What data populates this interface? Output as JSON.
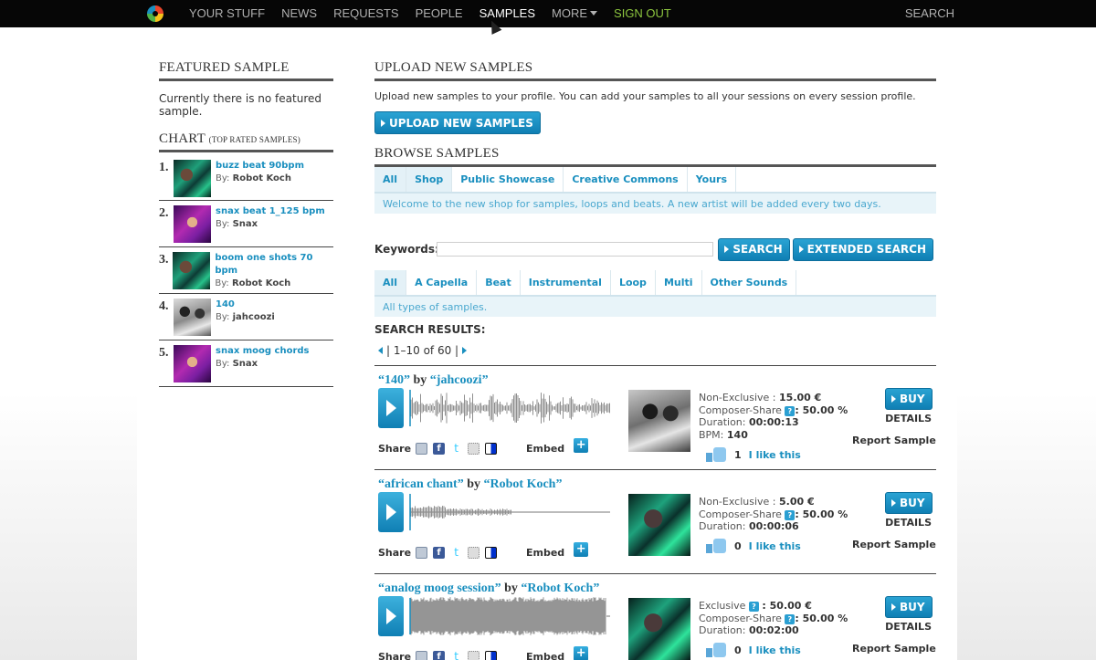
{
  "nav": {
    "items": [
      {
        "label": "YOUR STUFF",
        "active": false
      },
      {
        "label": "NEWS",
        "active": false
      },
      {
        "label": "REQUESTS",
        "active": false
      },
      {
        "label": "PEOPLE",
        "active": false
      },
      {
        "label": "SAMPLES",
        "active": true
      },
      {
        "label": "MORE",
        "active": false
      },
      {
        "label": "SIGN OUT",
        "active": false
      }
    ],
    "search": "SEARCH"
  },
  "left": {
    "featured_title": "FEATURED SAMPLE",
    "featured_text": "Currently there is no featured sample.",
    "chart_title": "CHART",
    "chart_subtitle": "(TOP RATED SAMPLES)",
    "chart": [
      {
        "num": "1.",
        "title": "buzz beat 90bpm",
        "by_label": "By:",
        "by": "Robot Koch"
      },
      {
        "num": "2.",
        "title": "snax beat 1_125 bpm",
        "by_label": "By:",
        "by": "Snax"
      },
      {
        "num": "3.",
        "title": "boom one shots 70 bpm",
        "by_label": "By:",
        "by": "Robot Koch"
      },
      {
        "num": "4.",
        "title": "140",
        "by_label": "By:",
        "by": "jahcoozi"
      },
      {
        "num": "5.",
        "title": "snax moog chords",
        "by_label": "By:",
        "by": "Snax"
      }
    ]
  },
  "upload": {
    "title": "UPLOAD NEW SAMPLES",
    "text": "Upload new samples to your profile. You can add your samples to all your sessions on every session profile.",
    "button": "UPLOAD NEW SAMPLES"
  },
  "browse": {
    "title": "BROWSE SAMPLES",
    "tabs": [
      "All",
      "Shop",
      "Public Showcase",
      "Creative Commons",
      "Yours"
    ],
    "note": "Welcome to the new shop for samples, loops and beats. A new artist will be added every two days.",
    "keywords_label": "Keywords:",
    "search_button": "SEARCH",
    "extended_button": "EXTENDED SEARCH",
    "categories": [
      "All",
      "A Capella",
      "Beat",
      "Instrumental",
      "Loop",
      "Multi",
      "Other Sounds"
    ],
    "category_note": "All types of samples.",
    "results_label": "SEARCH RESULTS:",
    "pager": "| 1–10 of 60 |"
  },
  "samples": [
    {
      "title": "“140”",
      "by_word": "by",
      "artist": "“jahcoozi”",
      "share": "Share",
      "embed": "Embed",
      "line1_label": "Non-Exclusive :",
      "line1_value": "15.00 €",
      "line2_label": "Composer-Share",
      "line2_value": ": 50.00 %",
      "line3_label": "Duration:",
      "line3_value": "00:00:13",
      "line4_label": "BPM:",
      "line4_value": "140",
      "likes": "1",
      "like_link": "I like this",
      "buy": "BUY",
      "details": "DETAILS",
      "report": "Report Sample"
    },
    {
      "title": "“african chant”",
      "by_word": "by",
      "artist": "“Robot Koch”",
      "share": "Share",
      "embed": "Embed",
      "line1_label": "Non-Exclusive :",
      "line1_value": "5.00 €",
      "line2_label": "Composer-Share",
      "line2_value": ": 50.00 %",
      "line3_label": "Duration:",
      "line3_value": "00:00:06",
      "line4_label": "",
      "line4_value": "",
      "likes": "0",
      "like_link": "I like this",
      "buy": "BUY",
      "details": "DETAILS",
      "report": "Report Sample"
    },
    {
      "title": "“analog moog session”",
      "by_word": "by",
      "artist": "“Robot Koch”",
      "share": "Share",
      "embed": "Embed",
      "line1_label": "Exclusive",
      "line1_value": ": 50.00 €",
      "line2_label": "Composer-Share",
      "line2_value": ": 50.00 %",
      "line3_label": "Duration:",
      "line3_value": "00:02:00",
      "line4_label": "",
      "line4_value": "",
      "likes": "0",
      "like_link": "I like this",
      "buy": "BUY",
      "details": "DETAILS",
      "report": "Report Sample"
    }
  ]
}
